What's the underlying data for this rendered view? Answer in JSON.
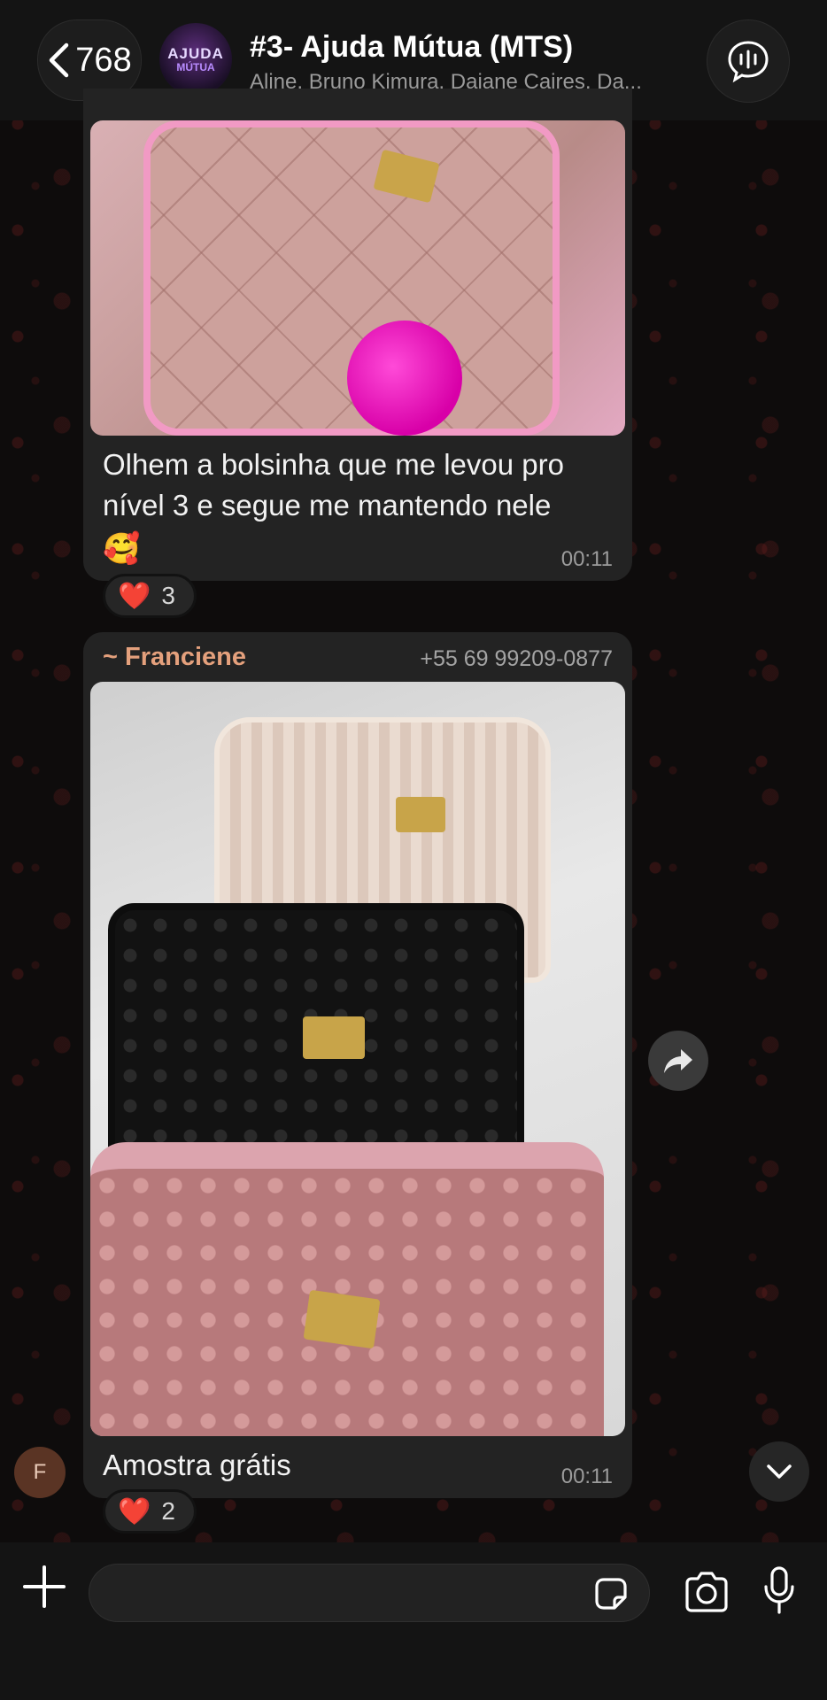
{
  "header": {
    "back_count": "768",
    "group_avatar_line1": "AJUDA",
    "group_avatar_line2": "MÚTUA",
    "title": "#3- Ajuda Mútua (MTS)",
    "subtitle": "Aline, Bruno Kimura, Daiane Caires, Da..."
  },
  "messages": [
    {
      "caption": "Olhem a bolsinha que me levou pro nível 3 e segue me mantendo nele",
      "emoji": "🥰",
      "time": "00:11",
      "reaction": {
        "emoji": "❤️",
        "count": "3"
      }
    },
    {
      "sender": "~ Franciene",
      "phone": "+55 69 99209-0877",
      "caption": "Amostra grátis",
      "time": "00:11",
      "reaction": {
        "emoji": "❤️",
        "count": "2"
      },
      "avatar_initial": "F"
    }
  ],
  "input": {
    "placeholder": "",
    "value": ""
  },
  "icons": {
    "back": "chevron-left-icon",
    "voice_chat": "voice-chat-icon",
    "forward": "forward-icon",
    "scroll_down": "chevron-down-icon",
    "plus": "plus-icon",
    "sticker": "sticker-icon",
    "camera": "camera-icon",
    "mic": "microphone-icon"
  },
  "colors": {
    "sender_name": "#e4a07c",
    "bubble": "#232323",
    "reaction_heart": "#e8252f"
  }
}
